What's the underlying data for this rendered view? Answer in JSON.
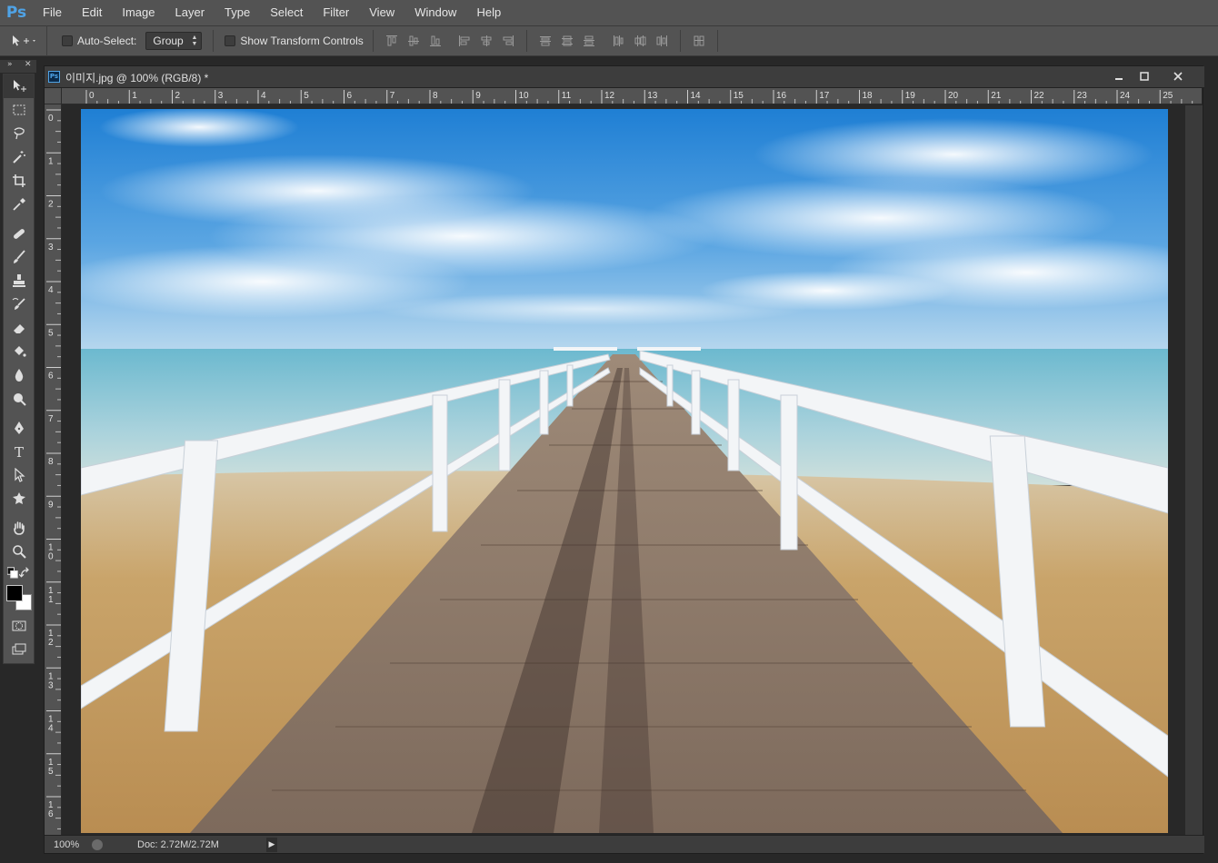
{
  "app": {
    "logo": "Ps"
  },
  "menu": [
    "File",
    "Edit",
    "Image",
    "Layer",
    "Type",
    "Select",
    "Filter",
    "View",
    "Window",
    "Help"
  ],
  "options": {
    "auto_select_label": "Auto-Select:",
    "auto_select_checked": false,
    "group_value": "Group",
    "show_transform_label": "Show Transform Controls",
    "show_transform_checked": false
  },
  "document": {
    "tab_title": "이미지.jpg @ 100% (RGB/8) *",
    "zoom": "100%",
    "doc_info": "Doc: 2.72M/2.72M"
  },
  "ruler": {
    "top_labels": [
      "0",
      "1",
      "2",
      "3",
      "4",
      "5",
      "6",
      "7",
      "8",
      "9",
      "10",
      "11",
      "12",
      "13",
      "14",
      "15",
      "16",
      "17",
      "18",
      "19",
      "20",
      "21",
      "22",
      "23",
      "24",
      "25"
    ],
    "left_labels": [
      "0",
      "1",
      "2",
      "3",
      "4",
      "5",
      "6",
      "7",
      "8",
      "9",
      "1\n0",
      "1\n1",
      "1\n2",
      "1\n3",
      "1\n4",
      "1\n5",
      "1\n6"
    ]
  },
  "colors": {
    "foreground": "#000000",
    "background": "#ffffff",
    "accent": "#4fa3e6"
  },
  "tools": [
    "move-tool",
    "marquee-tool",
    "lasso-tool",
    "magic-wand-tool",
    "crop-tool",
    "eyedropper-tool",
    "healing-brush-tool",
    "brush-tool",
    "clone-stamp-tool",
    "history-brush-tool",
    "eraser-tool",
    "paint-bucket-tool",
    "blur-tool",
    "dodge-tool",
    "pen-tool",
    "type-tool",
    "path-selection-tool",
    "shape-tool",
    "hand-tool",
    "zoom-tool"
  ]
}
